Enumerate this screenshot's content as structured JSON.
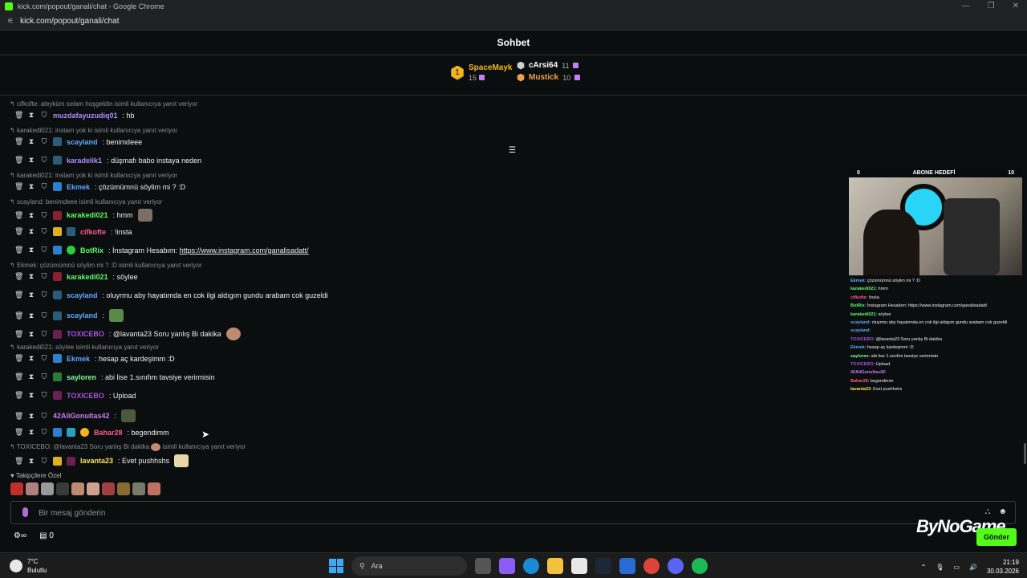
{
  "window": {
    "title": "kick.com/popout/ganali/chat - Google Chrome",
    "controls": [
      "—",
      "❐",
      "✕"
    ]
  },
  "address": {
    "url": "kick.com/popout/ganali/chat"
  },
  "chat": {
    "title": "Sohbet"
  },
  "leaderboard": {
    "first": {
      "rank": "1",
      "name": "SpaceMayk",
      "count": "15"
    },
    "others": [
      {
        "name": "cArsi64",
        "count": "11",
        "color": "#d0d0d0"
      },
      {
        "name": "Mustick",
        "count": "10",
        "color": "#f0a050"
      }
    ]
  },
  "replies": [
    {
      "text": "cifkofte: aleyküm selam hoşgeldin isimli kullanıcıya yanıt veriyor"
    },
    {
      "text": "karakedi021: instam yok ki isimli kullanıcıya yanıt veriyor"
    },
    {
      "text": "karakedi021: instam yok ki isimli kullanıcıya yanıt veriyor"
    },
    {
      "text": "scayland: benimdeee isimli kullanıcıya yanıt veriyor"
    },
    {
      "text": "Ekmek: çözümümnü söylim mi ? :D isimli kullanıcıya yanıt veriyor"
    },
    {
      "text": "karakedi021: söylee isimli kullanıcıya yanıt veriyor"
    },
    {
      "text": "TOXICEBO: @lavanta23 Soru yanlış Bi dakika",
      "suffix": "isimli kullanıcıya yanıt veriyor"
    }
  ],
  "messages": [
    {
      "user": "muzdafayuzudiq01",
      "color": "#b388ff",
      "text": "hb"
    },
    {
      "user": "scayland",
      "color": "#5fa8ff",
      "text": "benimdeee"
    },
    {
      "user": "karadelik1",
      "color": "#b388ff",
      "text": "düşmafı babo instaya neden"
    },
    {
      "user": "Ekmek",
      "color": "#5fa8ff",
      "text": "çözümümnü söylim mi ? :D"
    },
    {
      "user": "karakedi021",
      "color": "#5dff6a",
      "text": "hmm"
    },
    {
      "user": "cifkofte",
      "color": "#ff5a8a",
      "text": "!insta"
    },
    {
      "user": "BotRix",
      "color": "#5dff6a",
      "text": "İnstagram Hesabım:",
      "link": "https://www.instagram.com/ganalisadatt/"
    },
    {
      "user": "karakedi021",
      "color": "#5dff6a",
      "text": "söylee"
    },
    {
      "user": "scayland",
      "color": "#5fa8ff",
      "text": "oluyrmu aby hayatımda en cok ilgi aldıgım gundu arabam cok guzeldi"
    },
    {
      "user": "scayland",
      "color": "#5fa8ff",
      "text": ""
    },
    {
      "user": "TOXICEBO",
      "color": "#a552d8",
      "text": "@lavanta23 Soru yanlış Bi dakika"
    },
    {
      "user": "Ekmek",
      "color": "#5fa8ff",
      "text": "hesap aç kardeşimm :D"
    },
    {
      "user": "sayloren",
      "color": "#7dff9a",
      "text": "abi lise 1.sınıfım tavsiye verirmisin"
    },
    {
      "user": "TOXICEBO",
      "color": "#a552d8",
      "text": "Upload"
    },
    {
      "user": "42AliGonultas42",
      "color": "#c77df5",
      "text": ""
    },
    {
      "user": "Bahar28",
      "color": "#ff5a8a",
      "text": "begendimm"
    },
    {
      "user": "lavanta23",
      "color": "#ffe45a",
      "text": "Evet pushhshs"
    }
  ],
  "followers_label": "Takipçilere Özel",
  "input": {
    "placeholder": "Bir mesaj gönderin"
  },
  "bottom": {
    "count": "0"
  },
  "send_label": "Gönder",
  "watermark": "ByNoGame",
  "overlay": {
    "goal_left": "0",
    "goal_title": "ABONE HEDEFİ",
    "goal_right": "10",
    "chat": [
      {
        "user": "Ekmek",
        "color": "#5fa8ff",
        "text": ": çözümümnü söylim mi ? :D"
      },
      {
        "user": "karakedi021",
        "color": "#5dff6a",
        "text": ": hmm"
      },
      {
        "user": "cifkofte",
        "color": "#ff5a8a",
        "text": ": !insta"
      },
      {
        "user": "BotRix",
        "color": "#5dff6a",
        "text": ": İnstagram Hesabım: https://www.instagram.com/ganalisadatt/"
      },
      {
        "user": "karakedi021",
        "color": "#5dff6a",
        "text": ": söylee"
      },
      {
        "user": "scayland",
        "color": "#5fa8ff",
        "text": ": oluyrmu aby hayatımda en cok ilgi aldıgım gundu arabam cok guzeldi"
      },
      {
        "user": "scayland",
        "color": "#5fa8ff",
        "text": ":"
      },
      {
        "user": "TOXICEBO",
        "color": "#a552d8",
        "text": ": @lavanta23 Soru yanlış Bi dakika"
      },
      {
        "user": "Ekmek",
        "color": "#5fa8ff",
        "text": ": hesap aç kardeşimm :D"
      },
      {
        "user": "sayloren",
        "color": "#7dff9a",
        "text": ": abi lise 1.sınıfım tavsiye verirmisin"
      },
      {
        "user": "TOXICEBO",
        "color": "#a552d8",
        "text": ": Upload"
      },
      {
        "user": "42AliGonultas42",
        "color": "#c77df5",
        "text": ":"
      },
      {
        "user": "Bahar28",
        "color": "#ff5a8a",
        "text": ": begendimm"
      },
      {
        "user": "lavanta23",
        "color": "#ffe45a",
        "text": ": Evet pushhshs"
      }
    ]
  },
  "taskbar": {
    "temp": "7°C",
    "weather": "Bulutlu",
    "search": "Ara",
    "time": "21:19",
    "date": "30.03.2026"
  }
}
